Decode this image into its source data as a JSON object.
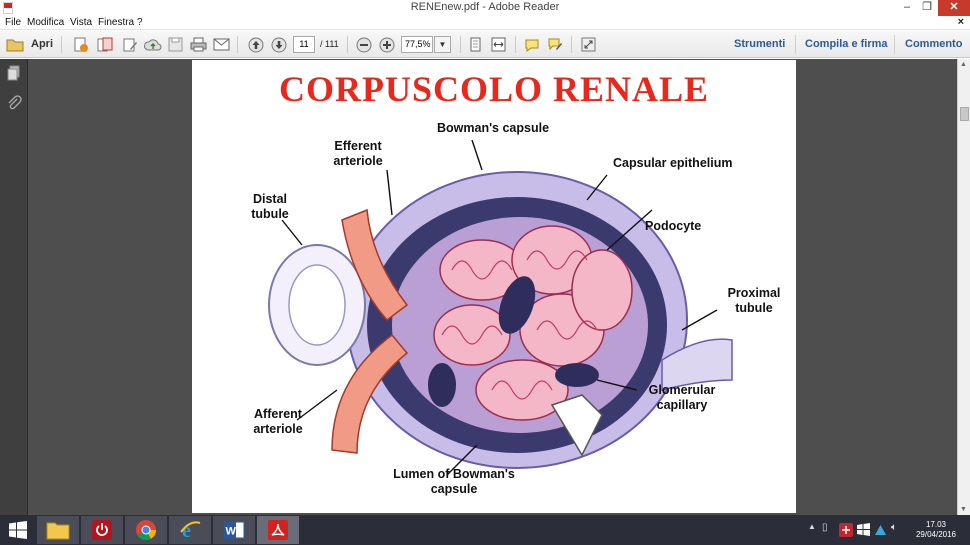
{
  "window": {
    "title": "RENEnew.pdf - Adobe Reader",
    "minimize": "–",
    "maximize": "❐",
    "close": "✕"
  },
  "menu": {
    "items": [
      "File",
      "Modifica",
      "Vista",
      "Finestra",
      "?"
    ],
    "close": "×"
  },
  "toolbar": {
    "open_label": "Apri",
    "current_page": "11",
    "total_pages": "/ 111",
    "zoom": "77,5%",
    "zoom_dropdown": "▼",
    "tools_link": "Strumenti",
    "fill_sign_link": "Compila e firma",
    "comment_link": "Commento"
  },
  "document": {
    "title": "CORPUSCOLO RENALE",
    "labels": {
      "bowmans_capsule": "Bowman's capsule",
      "efferent_arteriole": "Efferent arteriole",
      "capsular_epithelium": "Capsular epithelium",
      "distal_tubule": "Distal tubule",
      "podocyte": "Podocyte",
      "proximal_tubule": "Proximal tubule",
      "glomerular_capillary": "Glomerular capillary",
      "afferent_arteriole": "Afferent arteriole",
      "lumen": "Lumen of Bowman's capsule"
    }
  },
  "taskbar": {
    "apps": [
      "file-explorer",
      "power",
      "chrome",
      "internet-explorer",
      "word",
      "adobe-reader"
    ],
    "time": "17.03",
    "date": "29/04/2016"
  },
  "colors": {
    "title_red": "#e8281c",
    "link_blue": "#2b5b9b",
    "workspace": "#4e4e4e",
    "taskbar": "#2b2d39"
  }
}
